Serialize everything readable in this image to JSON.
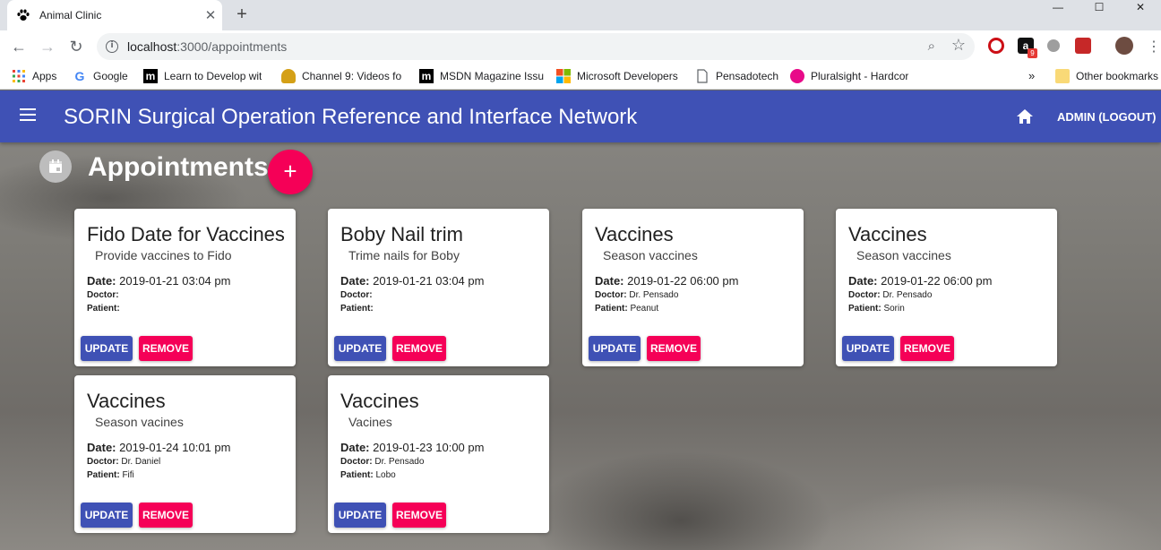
{
  "browser": {
    "tab_title": "Animal Clinic",
    "tab_close": "✕",
    "new_tab": "+",
    "window_controls": [
      "—",
      "☐",
      "✕"
    ],
    "url_host": "localhost",
    "url_path": ":3000/appointments",
    "bookmarks": [
      {
        "label": "Apps",
        "icon": "apps-grid-icon",
        "color": "#4285f4"
      },
      {
        "label": "Google",
        "icon": "google-icon",
        "color": "#4285f4"
      },
      {
        "label": "Learn to Develop wit",
        "icon": "m-icon",
        "color": "#000000"
      },
      {
        "label": "Channel 9: Videos fo",
        "icon": "channel9-icon",
        "color": "#d4a017"
      },
      {
        "label": "MSDN Magazine Issu",
        "icon": "m-icon",
        "color": "#000000"
      },
      {
        "label": "Microsoft Developers",
        "icon": "microsoft-icon",
        "color": "#f25022"
      },
      {
        "label": "Pensadotech",
        "icon": "page-icon",
        "color": "#5f6368"
      },
      {
        "label": "Pluralsight - Hardcor",
        "icon": "pluralsight-icon",
        "color": "#e80a89"
      }
    ],
    "overflow": "»",
    "other_bookmarks": "Other bookmarks",
    "ext_badge": "9"
  },
  "app": {
    "title": "SORIN Surgical Operation Reference and Interface Network",
    "logout": "ADMIN (LOGOUT)",
    "section_title": "Appointments",
    "add_label": "+",
    "colors": {
      "primary": "#3f51b5",
      "accent": "#f50057"
    }
  },
  "labels": {
    "date": "Date:",
    "doctor": "Doctor:",
    "patient": "Patient:",
    "update": "UPDATE",
    "remove": "REMOVE"
  },
  "appointments": [
    {
      "title": "Fido Date for Vaccines",
      "description": "Provide vaccines to Fido",
      "date": "2019-01-21 03:04 pm",
      "doctor": "",
      "patient": ""
    },
    {
      "title": "Boby Nail trim",
      "description": "Trime nails for Boby",
      "date": "2019-01-21 03:04 pm",
      "doctor": "",
      "patient": ""
    },
    {
      "title": "Vaccines",
      "description": "Season vaccines",
      "date": "2019-01-22 06:00 pm",
      "doctor": "Dr. Pensado",
      "patient": "Peanut"
    },
    {
      "title": "Vaccines",
      "description": "Season vaccines",
      "date": "2019-01-22 06:00 pm",
      "doctor": "Dr. Pensado",
      "patient": "Sorin"
    },
    {
      "title": "Vaccines",
      "description": "Season vacines",
      "date": "2019-01-24 10:01 pm",
      "doctor": "Dr. Daniel",
      "patient": "Fifi"
    },
    {
      "title": "Vaccines",
      "description": "Vacines",
      "date": "2019-01-23 10:00 pm",
      "doctor": "Dr. Pensado",
      "patient": "Lobo"
    }
  ]
}
